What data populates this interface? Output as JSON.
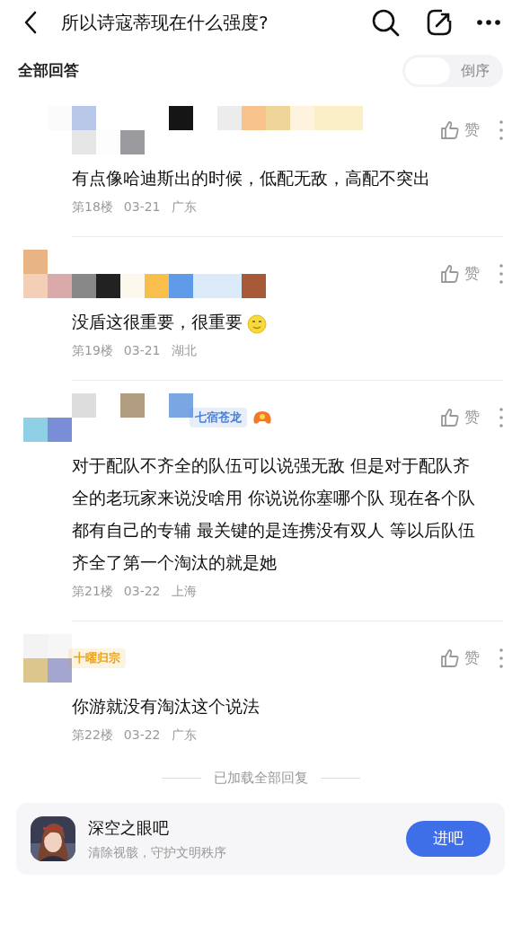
{
  "header": {
    "title": "所以诗寇蒂现在什么强度?"
  },
  "section": {
    "title": "全部回答",
    "sort_options": [
      {
        "label": "倒序",
        "selected": false
      }
    ]
  },
  "posts": [
    {
      "content": "有点像哈迪斯出的时候，低配无敌，高配不突出",
      "floor": "第18楼",
      "date": "03-21",
      "location": "广东",
      "like_label": "赞"
    },
    {
      "content": "没盾这很重要，很重要",
      "emoji": true,
      "floor": "第19楼",
      "date": "03-21",
      "location": "湖北",
      "like_label": "赞"
    },
    {
      "content": "对于配队不齐全的队伍可以说强无敌 但是对于配队齐全的老玩家来说没啥用 你说说你塞哪个队 现在各个队都有自己的专辅 最关键的是连携没有双人 等以后队伍齐全了第一个淘汰的就是她",
      "badge": {
        "text": "七宿苍龙",
        "color": "#4a7fd6"
      },
      "badge_icon": true,
      "floor": "第21楼",
      "date": "03-22",
      "location": "上海",
      "like_label": "赞"
    },
    {
      "content": "你游就没有淘汰这个说法",
      "badge": {
        "text": "十曜归宗",
        "color": "#e8a21c"
      },
      "floor": "第22楼",
      "date": "03-22",
      "location": "广东",
      "like_label": "赞"
    }
  ],
  "end_note": "已加载全部回复",
  "forum_card": {
    "name": "深空之眼吧",
    "slogan": "清除视骸，守护文明秩序",
    "button": "进吧"
  }
}
